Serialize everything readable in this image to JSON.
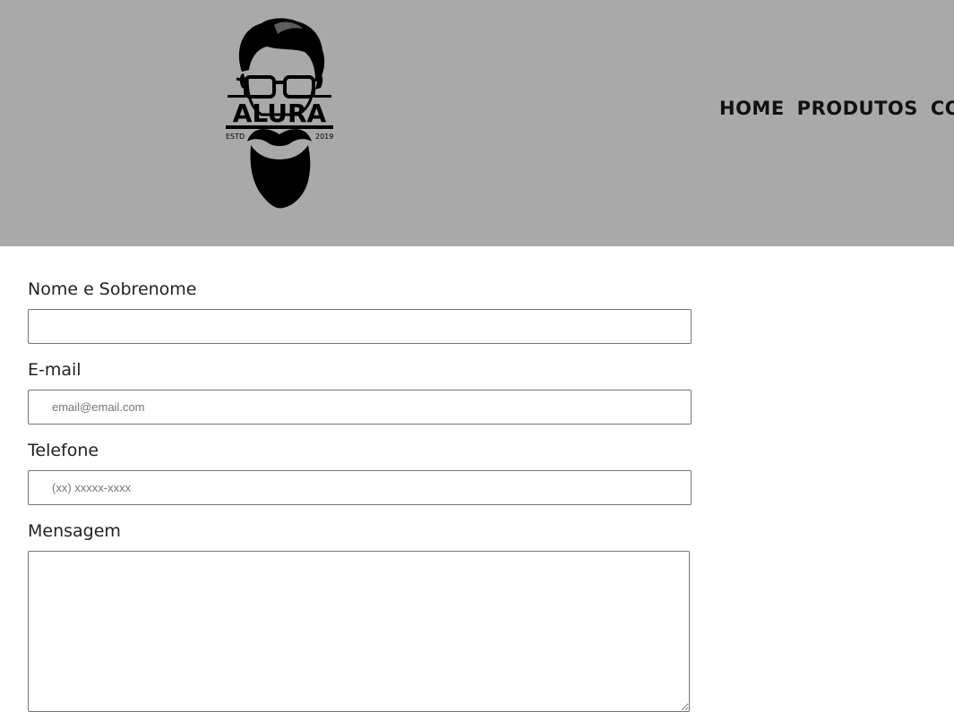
{
  "header": {
    "background_color": "#a9a9a9",
    "logo": {
      "icon": "bearded-man-glasses-logo",
      "brand_text": "ALURA",
      "estd_left": "ESTD",
      "estd_right": "2019"
    },
    "nav": {
      "items": [
        {
          "label": "HOME"
        },
        {
          "label": "PRODUTOS"
        },
        {
          "label": "CONTATO"
        }
      ]
    }
  },
  "form": {
    "name_label": "Nome e Sobrenome",
    "name_value": "",
    "email_label": "E-mail",
    "email_placeholder": "email@email.com",
    "phone_label": "Telefone",
    "phone_placeholder": "(xx) xxxxx-xxxx",
    "message_label": "Mensagem",
    "message_value": ""
  }
}
